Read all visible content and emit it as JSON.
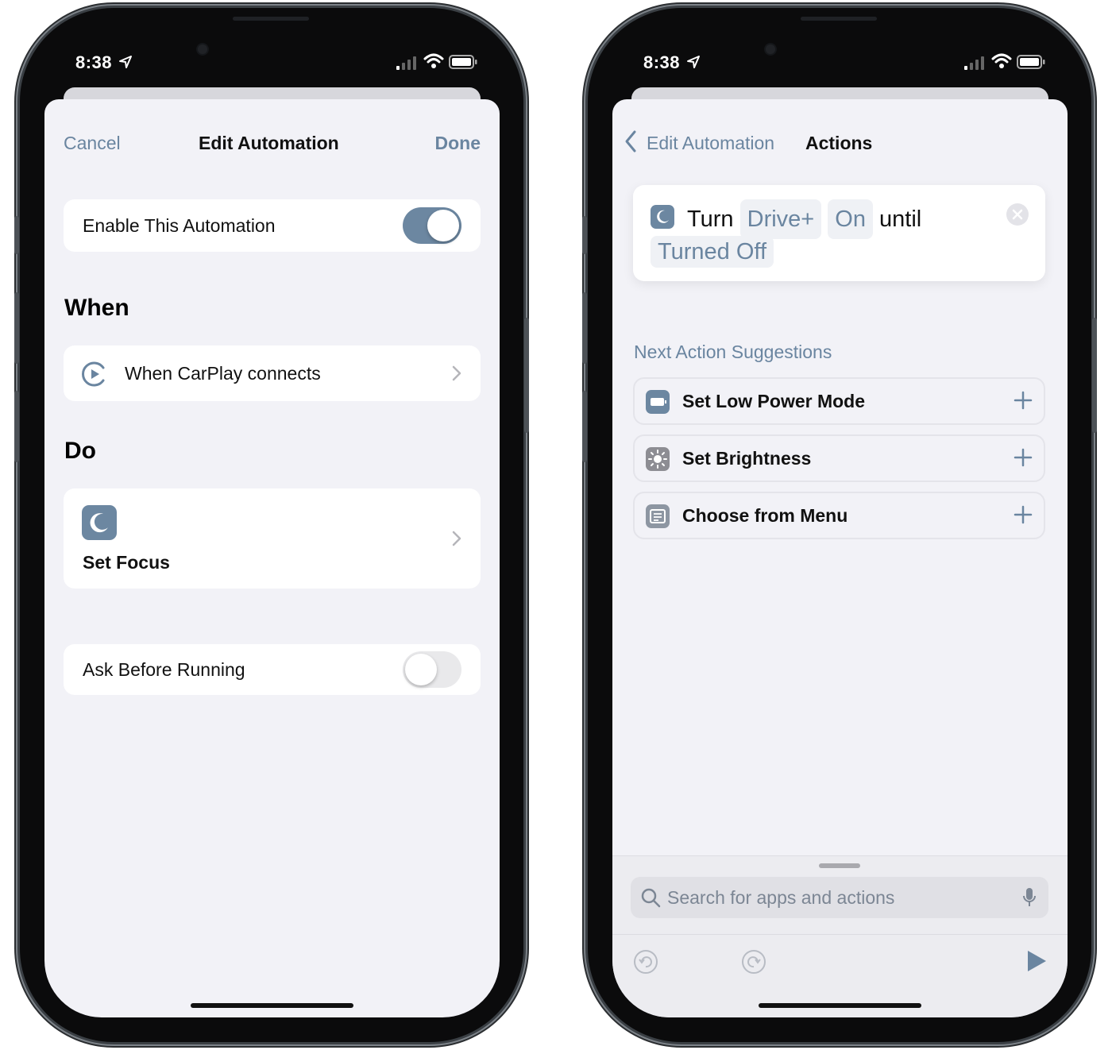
{
  "status_bar": {
    "time": "8:38"
  },
  "left_screen": {
    "nav": {
      "cancel": "Cancel",
      "title": "Edit Automation",
      "done": "Done"
    },
    "enable_row": {
      "label": "Enable This Automation",
      "toggle_on": true
    },
    "when_section": {
      "title": "When",
      "trigger_label": "When CarPlay connects"
    },
    "do_section": {
      "title": "Do",
      "action_label": "Set Focus"
    },
    "ask_row": {
      "label": "Ask Before Running",
      "toggle_on": false
    }
  },
  "right_screen": {
    "nav": {
      "back_label": "Edit Automation",
      "title": "Actions"
    },
    "action_card": {
      "word_turn": "Turn",
      "param_focus": "Drive+",
      "param_state": "On",
      "word_until": "until",
      "param_until": "Turned Off"
    },
    "suggestions": {
      "title": "Next Action Suggestions",
      "items": [
        {
          "label": "Set Low Power Mode",
          "icon": "battery-icon"
        },
        {
          "label": "Set Brightness",
          "icon": "brightness-icon"
        },
        {
          "label": "Choose from Menu",
          "icon": "menu-icon"
        }
      ]
    },
    "search": {
      "placeholder": "Search for apps and actions"
    }
  },
  "colors": {
    "accent": "#6a85a0",
    "toggle_on": "#6c87a1",
    "background": "#f2f2f7",
    "card": "#ffffff"
  }
}
